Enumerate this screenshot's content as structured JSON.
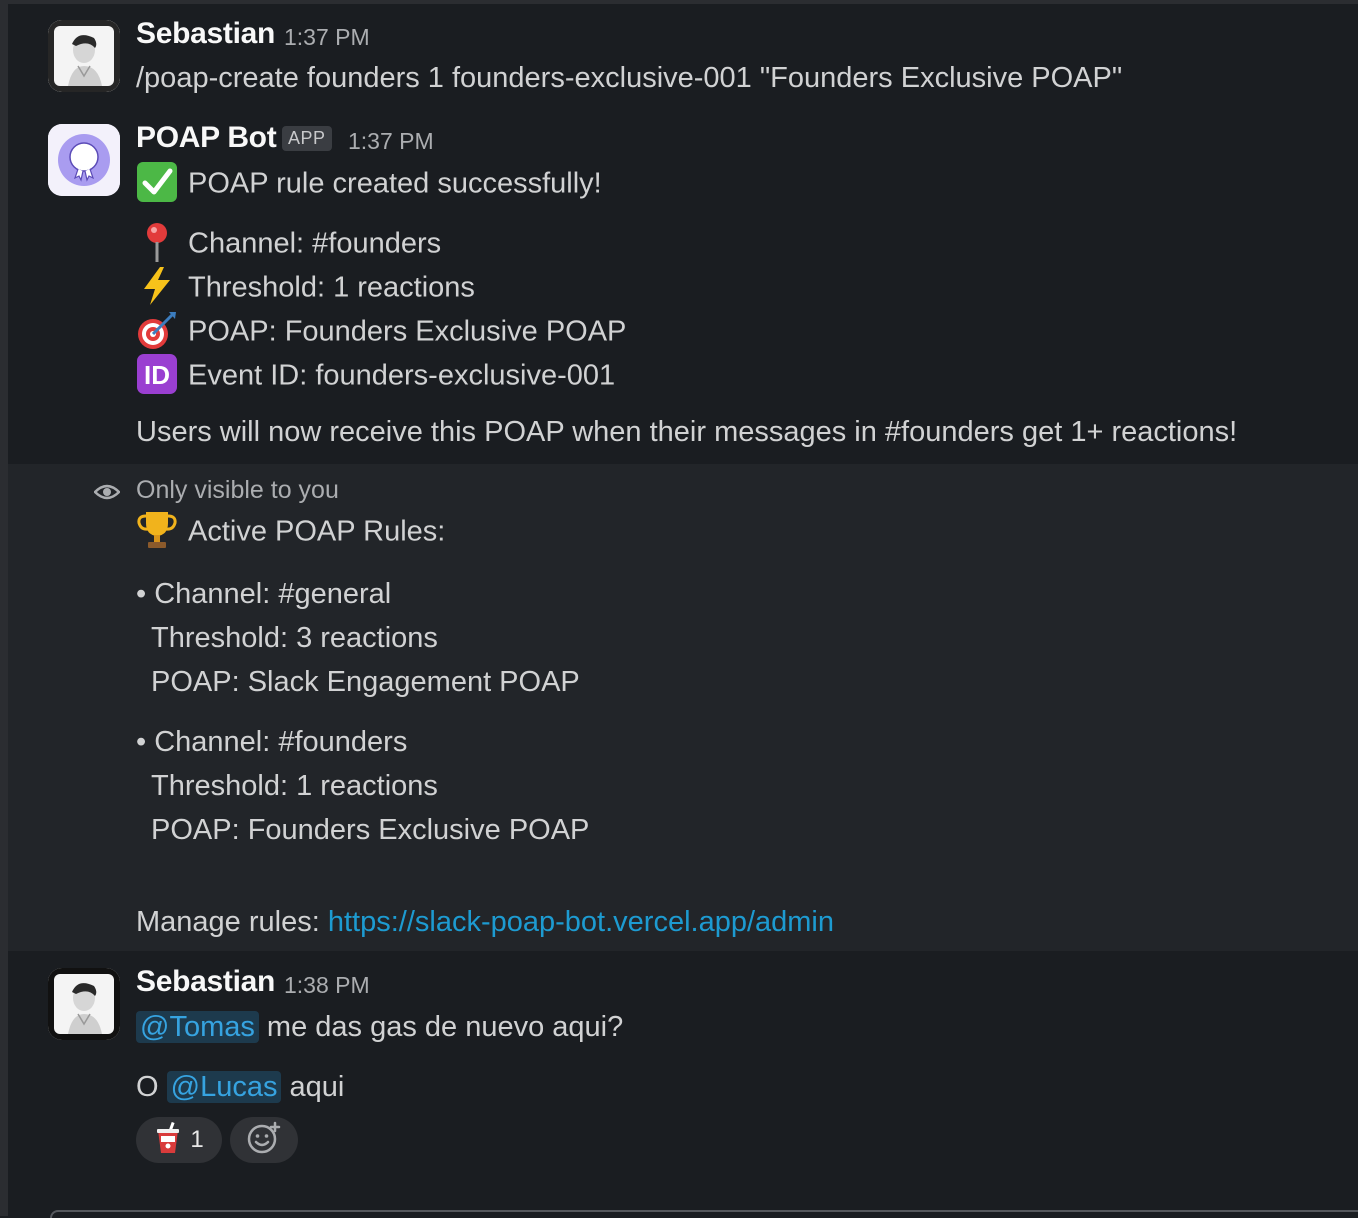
{
  "messages": [
    {
      "sender": "Sebastian",
      "time": "1:37 PM",
      "text": "/poap-create founders 1 founders-exclusive-001 \"Founders Exclusive POAP\""
    },
    {
      "sender": "POAP Bot",
      "badge": "APP",
      "time": "1:37 PM",
      "headline": "POAP rule created successfully!",
      "details": {
        "channel": "Channel: #founders",
        "threshold": "Threshold: 1 reactions",
        "poap": "POAP: Founders Exclusive POAP",
        "event": "Event ID: founders-exclusive-001"
      },
      "footer": "Users will now receive this POAP when their messages in #founders get 1+ reactions!"
    }
  ],
  "ephemeral": {
    "visibility": "Only visible to you",
    "title": "Active POAP Rules:",
    "rules": [
      {
        "channel": "• Channel: #general",
        "threshold": "Threshold: 3 reactions",
        "poap": "POAP: Slack Engagement POAP"
      },
      {
        "channel": "• Channel: #founders",
        "threshold": "Threshold: 1 reactions",
        "poap": "POAP: Founders Exclusive POAP"
      }
    ],
    "manage_label": "Manage rules:",
    "manage_link": "https://slack-poap-bot.vercel.app/admin"
  },
  "last_message": {
    "sender": "Sebastian",
    "time": "1:38 PM",
    "mention1": "@Tomas",
    "line1_rest": "me das gas de nuevo aqui?",
    "prefix2": "O",
    "mention2": "@Lucas",
    "line2_rest": "aqui",
    "reaction_count": "1"
  },
  "icons": {
    "check": "white-check-mark-icon",
    "pin": "round-pushpin-icon",
    "bolt": "zap-icon",
    "target": "direct-hit-icon",
    "id": "id-icon",
    "trophy": "trophy-icon",
    "eye": "eye-icon",
    "reaction": "cup-with-straw-icon",
    "add_reaction": "add-reaction-icon"
  },
  "colors": {
    "background": "#1a1d21",
    "ephemeral_bg": "#222529",
    "link": "#1d9bd1",
    "mention_bg": "#1d3a4d",
    "mention_text": "#36a3e0"
  }
}
